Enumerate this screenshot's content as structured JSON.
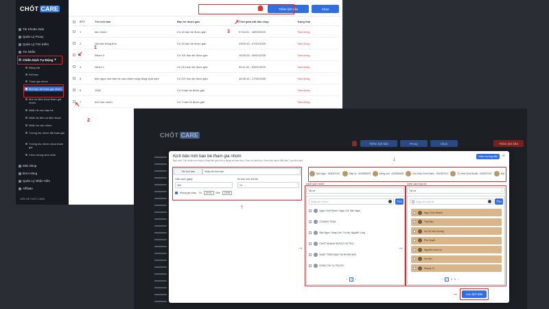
{
  "screenshot1": {
    "logo": {
      "part1": "CHỐT",
      "part2": "CARE"
    },
    "sidebar": {
      "items": [
        {
          "label": "Tài Khoản Zalo"
        },
        {
          "label": "Quản Lý Proxy"
        },
        {
          "label": "Quản Lý Tìm Kiếm"
        },
        {
          "label": "Tin Nhắn"
        },
        {
          "label": "Chiến Dịch Tự Động"
        }
      ],
      "subitems": [
        {
          "label": "Đăng bài"
        },
        {
          "label": "Kết bạn"
        },
        {
          "label": "Tham gia nhóm"
        },
        {
          "label": "Mời bạn bè tham gia nhóm"
        },
        {
          "label": "Mời số điện thoại tham gia nhóm"
        },
        {
          "label": "Nhắn tin cho bạn bè"
        },
        {
          "label": "Nhắn tin đến số điện thoại"
        },
        {
          "label": "Nhắn tin vào nhóm"
        },
        {
          "label": "Tương tác nhóm đã tham gia"
        },
        {
          "label": "Tương tác nhóm chưa tham gia"
        },
        {
          "label": "Chức mừng sinh nhật"
        }
      ],
      "bottom_items": [
        {
          "label": "Mini Shop"
        },
        {
          "label": "Đơn Hàng"
        },
        {
          "label": "Quản Lý Nhân Viên"
        },
        {
          "label": "Affiliate"
        }
      ],
      "footer": "LIÊN HỆ CHỐT CARE"
    },
    "topbar": {
      "create_button": "Thêm lịch bản",
      "second_button": "Chọn"
    },
    "table": {
      "headers": [
        "STT",
        "Tên lịch bản",
        "Bạn bè được gán",
        "Thời gian bắt đầu chạy",
        "Trạng thái"
      ],
      "rows": [
        {
          "stt": "1",
          "name": "kéo nhóm",
          "friends": "Có 16 bạn bè được gán",
          "time": "07/11/41 - 18/02/2025",
          "status": "Tạm dừng"
        },
        {
          "stt": "2",
          "name": "Hội báo trang tính",
          "friends": "Có 33 bạn bè được gán",
          "time": "29/01/10 - 07/01/2025",
          "status": "Tạm dừng"
        },
        {
          "stt": "3",
          "name": "Nhóm 3",
          "friends": "Có 101 bạn bè được gán",
          "time": "15:00:25 - 06/01/2025",
          "status": "Tạm dừng"
        },
        {
          "stt": "4",
          "name": "Nhóm 1",
          "friends": "Có 214 bạn bè được gán",
          "time": "09:11:32 - 03/01/2025",
          "status": "Tạm dừng"
        },
        {
          "stt": "5",
          "name": "bảo ngọc mời bạn bè vào nhóm cộng đồng chốt care",
          "friends": "Có 237 bạn bè được gán",
          "time": "16:45:16 - 27/02/2025",
          "status": "Tạm dừng"
        },
        {
          "stt": "6",
          "name": "1930",
          "friends": "Có 9 bạn bè được gán",
          "time": "",
          "status": "Tạm dừng"
        },
        {
          "stt": "7",
          "name": "mời vào nhóm",
          "friends": "Có 7 bạn bè được gán",
          "time": "",
          "status": "Tạm dừng"
        }
      ]
    },
    "annotations": [
      "1",
      "2",
      "3"
    ]
  },
  "screenshot2": {
    "topbar": {
      "btn1": "Thêm lịch bản",
      "btn2": "Proxy",
      "btn3": "Chọn",
      "btn4": "Thêm lịch bản"
    },
    "modal": {
      "title": "Kịch bản mời bạn bè tham gia nhóm",
      "breadcrumb": "Bạn mới: Tài khoản mời bạn ▸ Nhập tên giới chú ▸ Nhập số bạn bè ▸ Chọn số bạn bè ▸ Chọn lịch bản ▸ Bắt đầu \"Lưu lịch bản\"",
      "guide_button": "Video hướng dẫn",
      "close": "×",
      "tabs": [
        "Tên lịch bản",
        "Nhập tên lịch bản"
      ],
      "fields": {
        "label1": "Giãn cách (giây)",
        "value1": "300",
        "label2": "Số bạn mời mỗi lần",
        "value2": "10",
        "repeat_label": "Khung giờ chạy:",
        "from_label": "Từ",
        "from_value": "00:00",
        "to_label": "Đến",
        "to_value": "23:59"
      },
      "accounts": [
        "Bảo Ngọc - 0432527047",
        "Diệp Lộ - 0402856975",
        "Hồng Linh - 0432805609",
        "Kim Khoa Chốt Nhanh - 0432527047",
        "Tư Minh Chốt Nhanh - 0432527047",
        "Đăng Ca - 047488"
      ],
      "left_list": {
        "section_label": "Danh sách nhóm",
        "select_value": "Tất cả",
        "search_placeholder": "Nhập tên nhóm",
        "search_button": "Tìm",
        "items": [
          "Ngọc Chốt Nhanh, Ngọc Chi, Bảo Ngọc",
          "CODING TEAM",
          "Bảo Ngọc, Hồng Linh, Trà My, Nguyễn Long",
          "CHỐT NHANH INVEST HỖ TRỢ",
          "NHẬT TRIỂN BẢN TIN NHÓM MỚI",
          "ĐỒNG TÂY 11 TRƯỚC"
        ],
        "pages": [
          "‹",
          "1",
          "›"
        ]
      },
      "right_list": {
        "section_label": "Danh sách bạn bè",
        "select_value": "Tất cả",
        "search_placeholder": "Nhập tên bạn bè",
        "search_button": "Tìm",
        "items": [
          "Ngọc Chốt Nhanh",
          "Thái Bảo",
          "Hạ Thị Hoa Hương",
          "Phú Quyết",
          "Nguyễn Hoài Lộc",
          "Hà Nhu",
          "Nhung Tú"
        ],
        "pages": [
          "‹",
          "1",
          "2",
          "3",
          "›"
        ]
      },
      "save_button": "Lưu lịch bản"
    }
  },
  "colors": {
    "accent": "#2f6fe0",
    "annotation": "#e02424",
    "selected": "#d9b68a",
    "status": "#e03131"
  }
}
